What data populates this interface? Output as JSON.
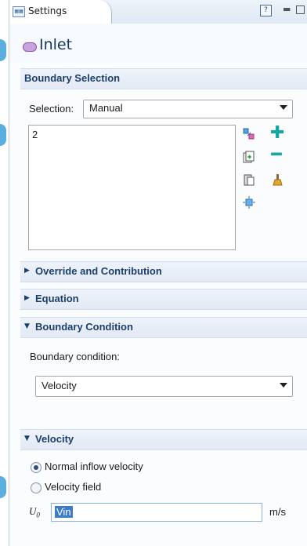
{
  "window": {
    "tab_label": "Settings",
    "tab_icon": "settings-grid-icon",
    "help_icon": "help-icon",
    "minimize_icon": "minimize-icon",
    "maximize_icon": "maximize-icon"
  },
  "title": {
    "text": "Inlet",
    "icon": "inlet-boundary-icon"
  },
  "sections": {
    "boundary_selection": {
      "label": "Boundary Selection",
      "selection_label": "Selection:",
      "selection_value": "Manual",
      "list_items": [
        "2"
      ],
      "tools": [
        "paste-selection-icon",
        "add-to-selection-icon",
        "copy-selection-icon",
        "remove-from-selection-icon",
        "clear-selection-icon",
        "clear-brush-icon",
        "zoom-to-selection-icon"
      ]
    },
    "override": {
      "label": "Override and Contribution",
      "expanded": false
    },
    "equation": {
      "label": "Equation",
      "expanded": false
    },
    "boundary_condition": {
      "label": "Boundary Condition",
      "expanded": true,
      "field_label": "Boundary condition:",
      "value": "Velocity"
    },
    "velocity": {
      "label": "Velocity",
      "expanded": true,
      "options": [
        {
          "label": "Normal inflow velocity",
          "checked": true
        },
        {
          "label": "Velocity field",
          "checked": false
        }
      ],
      "u0_symbol": "U",
      "u0_subscript": "0",
      "u0_value": "Vin",
      "u0_unit": "m/s"
    }
  }
}
